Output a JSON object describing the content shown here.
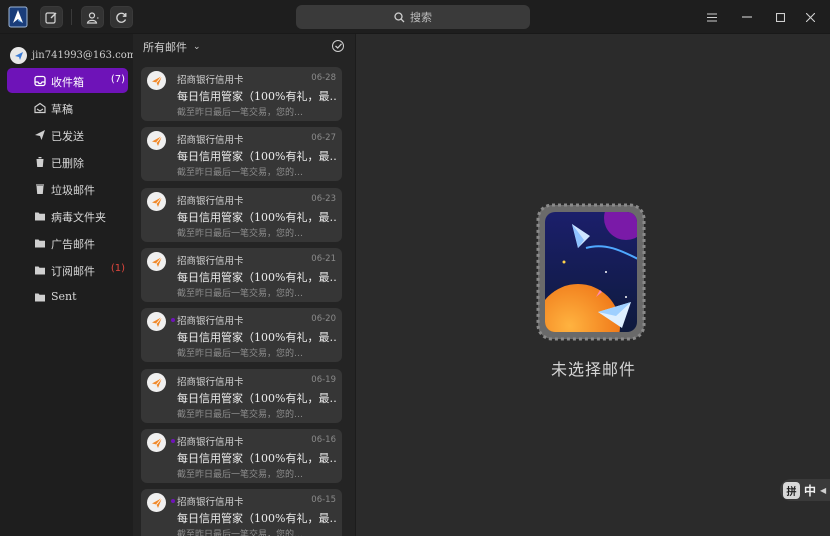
{
  "toolbar": {
    "search_placeholder": "搜索"
  },
  "account": {
    "email": "jin741993@163.com"
  },
  "folders": [
    {
      "label": "收件箱",
      "icon": "inbox-icon",
      "count": "(7)",
      "active": true
    },
    {
      "label": "草稿",
      "icon": "draft-icon",
      "count": ""
    },
    {
      "label": "已发送",
      "icon": "send-icon",
      "count": ""
    },
    {
      "label": "已删除",
      "icon": "trash-icon",
      "count": ""
    },
    {
      "label": "垃圾邮件",
      "icon": "spam-icon",
      "count": ""
    },
    {
      "label": "病毒文件夹",
      "icon": "folder-icon",
      "count": ""
    },
    {
      "label": "广告邮件",
      "icon": "folder-icon",
      "count": ""
    },
    {
      "label": "订阅邮件",
      "icon": "folder-icon",
      "count": "(1)"
    },
    {
      "label": "Sent",
      "icon": "folder-icon",
      "count": ""
    }
  ],
  "list": {
    "filter_label": "所有邮件",
    "messages": [
      {
        "sender": "招商银行信用卡",
        "date": "06-28",
        "subject": "每日信用管家（100%有礼，最…",
        "preview": "截至昨日最后一笔交易，您的…",
        "unread": false
      },
      {
        "sender": "招商银行信用卡",
        "date": "06-27",
        "subject": "每日信用管家（100%有礼，最…",
        "preview": "截至昨日最后一笔交易，您的…",
        "unread": false
      },
      {
        "sender": "招商银行信用卡",
        "date": "06-23",
        "subject": "每日信用管家（100%有礼，最…",
        "preview": "截至昨日最后一笔交易，您的…",
        "unread": false
      },
      {
        "sender": "招商银行信用卡",
        "date": "06-21",
        "subject": "每日信用管家（100%有礼，最…",
        "preview": "截至昨日最后一笔交易，您的…",
        "unread": false
      },
      {
        "sender": "招商银行信用卡",
        "date": "06-20",
        "subject": "每日信用管家（100%有礼，最…",
        "preview": "截至昨日最后一笔交易，您的…",
        "unread": true
      },
      {
        "sender": "招商银行信用卡",
        "date": "06-19",
        "subject": "每日信用管家（100%有礼，最…",
        "preview": "截至昨日最后一笔交易，您的…",
        "unread": false
      },
      {
        "sender": "招商银行信用卡",
        "date": "06-16",
        "subject": "每日信用管家（100%有礼，最…",
        "preview": "截至昨日最后一笔交易，您的…",
        "unread": true
      },
      {
        "sender": "招商银行信用卡",
        "date": "06-15",
        "subject": "每日信用管家（100%有礼，最…",
        "preview": "截至昨日最后一笔交易，您的…",
        "unread": true
      }
    ]
  },
  "reader": {
    "empty_text": "未选择邮件"
  },
  "ime": {
    "pinyin_badge": "拼",
    "mode": "中"
  },
  "colors": {
    "accent": "#6e13b8",
    "unread_count_red": "#e0463d"
  }
}
